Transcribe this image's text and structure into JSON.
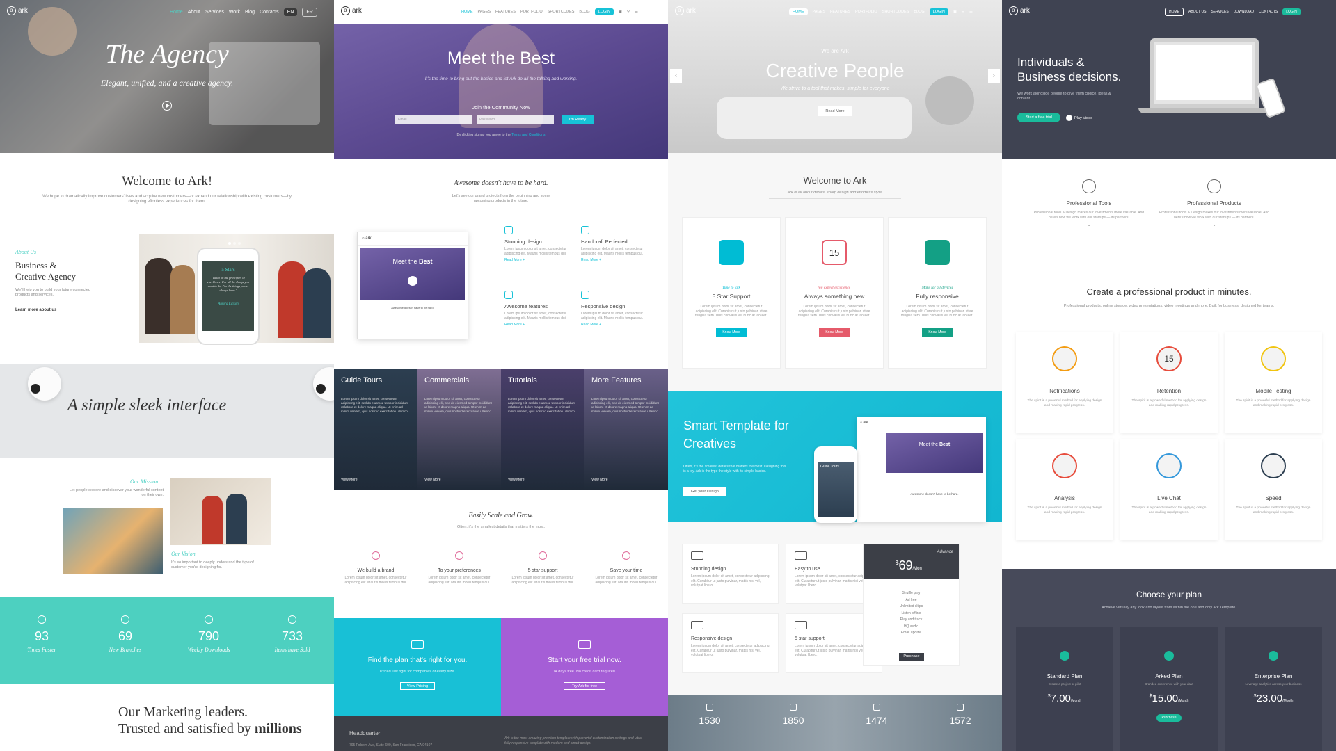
{
  "c1": {
    "logo": "ark",
    "nav": [
      "Home",
      "About",
      "Services",
      "Work",
      "Blog",
      "Contacts",
      "EN",
      "FR"
    ],
    "hero_title": "The Agency",
    "hero_sub": "Elegant, unified, and a creative agency.",
    "welcome": "Welcome to Ark!",
    "welcome_text": "We hope to dramatically improve customers' lives and acquire new customers—or expand our relationship with existing customers—by designing effortless experiences for them.",
    "about_kicker": "About Us",
    "about_title_1": "Business &",
    "about_title_2": "Creative Agency",
    "about_text": "We'll help you to build your future connected products and services.",
    "about_link": "Learn more about us",
    "phone_title": "5 Stars",
    "phone_quote": "\"Build on the principles of excellence. For all the things you want to do. Pro the things you've always been.\"",
    "phone_name": "Aurora Edison",
    "sleek": "A simple sleek interface",
    "mission_title": "Our Mission",
    "mission_text": "Let people explore and discover your wonderful content on their own.",
    "vision_title": "Our Vision",
    "vision_text": "It's so important to deeply understand the type of customer you're designing for.",
    "stats": [
      {
        "n": "93",
        "l": "Times Faster",
        "i": "gauge-icon"
      },
      {
        "n": "69",
        "l": "New Branches",
        "i": "map-pin-icon"
      },
      {
        "n": "790",
        "l": "Weekly Downloads",
        "i": "cloud-download-icon"
      },
      {
        "n": "733",
        "l": "Items have Sold",
        "i": "wallet-icon"
      }
    ],
    "marketing_1": "Our Marketing leaders.",
    "marketing_2": "Trusted and satisfied by",
    "marketing_bold": "millions"
  },
  "c2": {
    "logo": "ark",
    "nav": [
      "HOME",
      "PAGES",
      "FEATURES",
      "PORTFOLIO",
      "SHORTCODES",
      "BLOG",
      "LOGIN"
    ],
    "hero_title_1": "Meet the",
    "hero_title_2": "Best",
    "hero_sub": "It's the time to bring out the basics and let Ark do all the talking and working.",
    "join": "Join the Community Now",
    "email_ph": "Email",
    "password_ph": "Password",
    "ready": "I'm Ready",
    "terms": "By clicking signup you agree to the",
    "terms_link": "Terms and Conditions",
    "awesome": "Awesome doesn't have to be hard.",
    "awesome_sub": "Let's see our grand projects from the beginning and some upcoming products in the future.",
    "mini_title_1": "Meet the",
    "mini_title_2": "Best",
    "mini_text": "Awesome doesn't have to be hard.",
    "features": [
      {
        "t": "Stunning design",
        "i": "atom-icon"
      },
      {
        "t": "Handcraft Perfected",
        "i": "chart-icon"
      },
      {
        "t": "Awesome features",
        "i": "tools-icon"
      },
      {
        "t": "Responsive design",
        "i": "devices-icon"
      }
    ],
    "feature_text": "Lorem ipsum dolor sit amet, consectetur adipiscing elit. Mauris mollis tempus dui.",
    "read_more": "Read More +",
    "tiles": [
      {
        "t": "Guide Tours",
        "c": "#2c3e50"
      },
      {
        "t": "Commercials",
        "c": "#7f6e93"
      },
      {
        "t": "Tutorials",
        "c": "#4a3f6b"
      },
      {
        "t": "More Features",
        "c": "#6a6089"
      }
    ],
    "tile_text": "Lorem ipsum dolor sit amet, consectetur adipiscing elit, sed do eiusmod tempor incididunt ut labore et dolore magna aliqua. Ut enim ad minim veniam, quis nostrud exercitation ullamco.",
    "view_more": "View More",
    "scale_title": "Easily Scale and Grow.",
    "scale_sub": "Often, it's the smallest details that matters the most.",
    "grow": [
      {
        "t": "We build a brand",
        "i": "pin-icon"
      },
      {
        "t": "To your preferences",
        "i": "heart-icon"
      },
      {
        "t": "5 star support",
        "i": "chat-icon"
      },
      {
        "t": "Save your time",
        "i": "clock-icon"
      }
    ],
    "grow_text": "Lorem ipsum dolor sit amet, consectetur adipiscing elit. Mauris mollis tempus dui.",
    "plan_title": "Find the plan that's right for you.",
    "plan_sub": "Priced just right for companies of every size.",
    "plan_btn": "View Pricing",
    "trial_title": "Start your free trial now.",
    "trial_sub": "14 days free. No credit card required.",
    "trial_btn": "Try Ark for free",
    "hq": "Headquarter",
    "hq_addr": "795 Folsom Ave, Suite 600, San Francisco, CA 94107",
    "quote": "Ark is the most amazing premium template with powerful customization settings and ultra fully responsive template with modern and smart design."
  },
  "c3": {
    "logo": "ark",
    "nav": [
      "HOME",
      "PAGES",
      "FEATURES",
      "PORTFOLIO",
      "SHORTCODES",
      "BLOG",
      "LOGIN"
    ],
    "kicker": "We are Ark",
    "hero_title": "Creative People",
    "hero_sub": "We strive to a tool that makes, simple for everyone",
    "read_more": "Read More",
    "welcome": "Welcome to Ark",
    "welcome_sub": "Ark is all about details, sharp design and effortless style.",
    "cards": [
      {
        "k": "Time to talk",
        "t": "5 Star Support",
        "b": "Know More",
        "c": "#00bcd4",
        "i": "chat-bubbles-icon"
      },
      {
        "k": "We expect excellence",
        "t": "Always something new",
        "b": "Know More",
        "c": "#e55a6a",
        "i": "calendar-icon"
      },
      {
        "k": "Make for all devices",
        "t": "Fully responsive",
        "b": "Know More",
        "c": "#13a085",
        "i": "tablet-icon"
      }
    ],
    "card_text": "Lorem ipsum dolor sit amet, consectetur adipiscing elit. Curabitur ut justo pulvinar, vitae fringilla sem. Duis convallis vel nunc at laoreet.",
    "cal_day": "15",
    "smart_1": "Smart Template for",
    "smart_2": "Creatives",
    "smart_text": "Often, it's the smallest details that matters the most. Designing this is a joy. Ark is the type the style with its simple basics.",
    "smart_btn": "Get your Design",
    "mock_title_1": "Meet the",
    "mock_title_2": "Best",
    "mock_tour": "Guide Tours",
    "mock_text": "Awesome doesn't have to be hard.",
    "feats": [
      {
        "t": "Stunning design",
        "i": "bicycle-icon"
      },
      {
        "t": "Easy to use",
        "i": "download-icon"
      },
      {
        "t": "Responsive design",
        "i": "devices-icon"
      },
      {
        "t": "5 star support",
        "i": "envelope-icon"
      }
    ],
    "feat_text": "Lorem ipsum dolor sit amet, consectetur adipiscing elit. Curabitur ut justo pulvinar, mattis nisi vel, volutpat libero.",
    "price_label": "Advance",
    "price": "69",
    "price_cur": "$",
    "price_per": "/Mon",
    "price_items": [
      "Shuffle play",
      "Ad free",
      "Unlimited skips",
      "Listen offline",
      "Play and track",
      "HQ audio",
      "Email update"
    ],
    "purchase": "Purchase",
    "stats": [
      {
        "n": "1530",
        "i": "tools-icon"
      },
      {
        "n": "1850",
        "i": "layers-icon"
      },
      {
        "n": "1474",
        "i": "cup-icon"
      },
      {
        "n": "1572",
        "i": "trophy-icon"
      }
    ]
  },
  "c4": {
    "logo": "ark",
    "nav": [
      "HOME",
      "ABOUT US",
      "SERVICES",
      "DOWNLOAD",
      "CONTACTS",
      "LOGIN"
    ],
    "hero_1": "Individuals &",
    "hero_2": "Business decisions.",
    "hero_text": "We work alongside people to give them choice, ideas & content.",
    "trial_btn": "Start a free trial",
    "play": "Play Video",
    "pro": [
      {
        "t": "Professional Tools",
        "i": "gears-icon"
      },
      {
        "t": "Professional Products",
        "i": "bulb-icon"
      }
    ],
    "pro_text": "Professional tools & Design makes our investments more valuable. And here's how we work with our startups — its partners.",
    "create": "Create a professional product in minutes.",
    "create_sub": "Professional products, online storage, video presentations, video meetings and more. Built for business, designed for teams.",
    "grid": [
      {
        "t": "Notifications",
        "i": "mail-icon"
      },
      {
        "t": "Retention",
        "i": "calendar-icon"
      },
      {
        "t": "Mobile Testing",
        "i": "tablet-icon"
      },
      {
        "t": "Analysis",
        "i": "newspaper-icon"
      },
      {
        "t": "Live Chat",
        "i": "chat-bubbles-icon"
      },
      {
        "t": "Speed",
        "i": "clock-icon"
      }
    ],
    "grid_text": "The spirit is a powerful method for applying design and making rapid progress.",
    "cal_day": "15",
    "plan_title": "Choose your plan",
    "plan_sub": "Achieve virtually any look and layout from within the one and only Ark Template.",
    "plans": [
      {
        "t": "Standard Plan",
        "s": "Create a project or pilot",
        "p": "7.00"
      },
      {
        "t": "Arked Plan",
        "s": "Branded experience with your data",
        "p": "15.00"
      },
      {
        "t": "Enterprise Plan",
        "s": "Leverage analytics across your business",
        "p": "23.00"
      }
    ],
    "per": "/Month",
    "cur": "$",
    "purchase": "Purchase",
    "accent": "#1abc9c"
  }
}
